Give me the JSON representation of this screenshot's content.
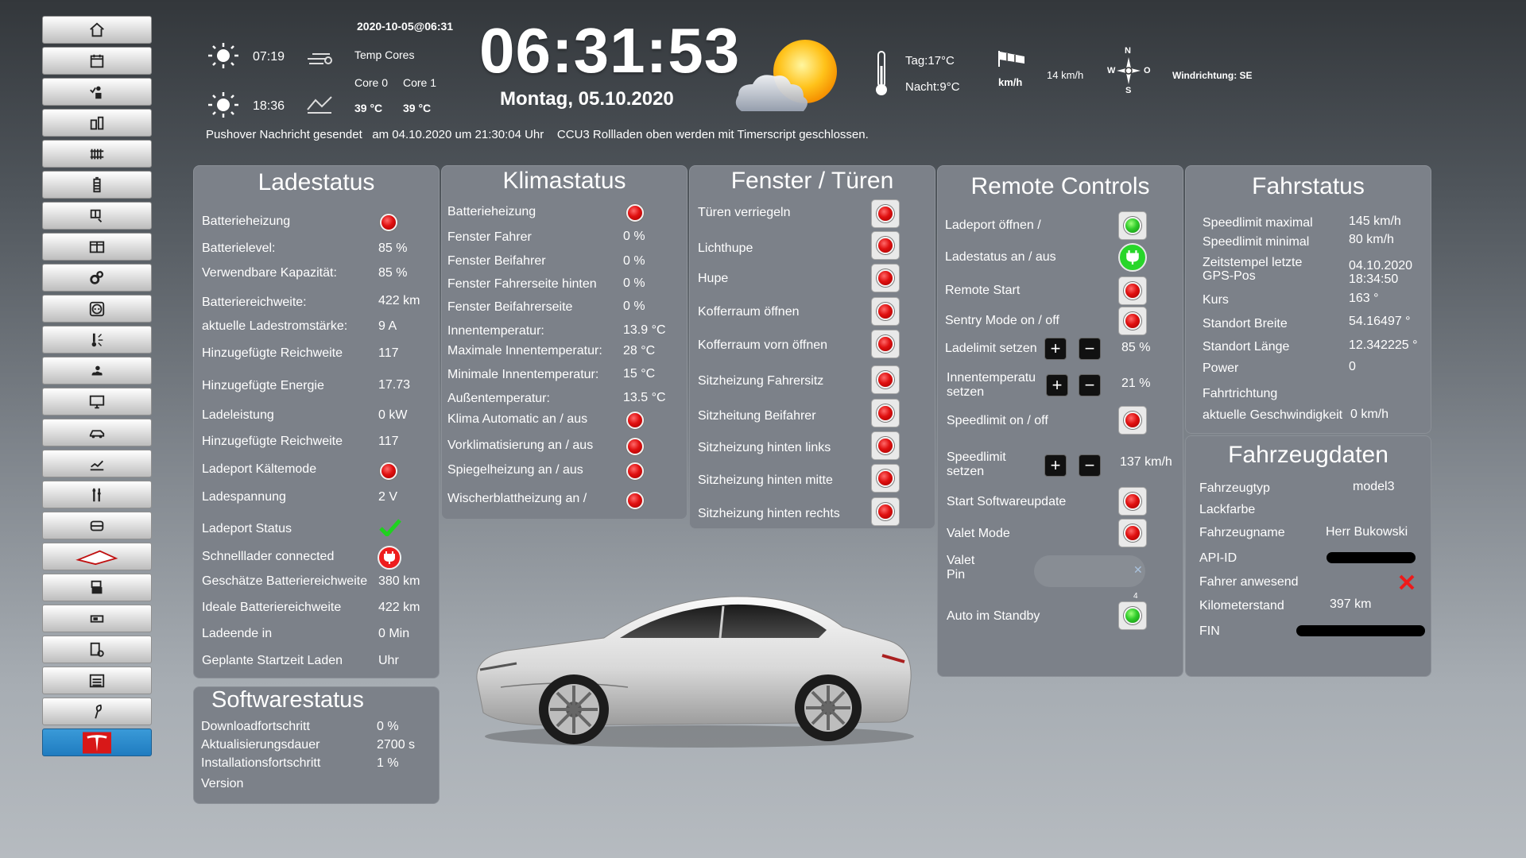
{
  "colors": {
    "panel": "#7c8189",
    "accent_blue": "#1f7cc0",
    "status_red": "#e01010",
    "status_green": "#2fcc2a"
  },
  "sidebar": {
    "items": [
      {
        "icon": "home-icon"
      },
      {
        "icon": "calendar-icon"
      },
      {
        "icon": "person-check-icon"
      },
      {
        "icon": "meter-icon"
      },
      {
        "icon": "radiator-icon"
      },
      {
        "icon": "battery-icon"
      },
      {
        "icon": "window-icon"
      },
      {
        "icon": "split-window-icon"
      },
      {
        "icon": "gears-icon"
      },
      {
        "icon": "socket-icon"
      },
      {
        "icon": "thermometer-icon"
      },
      {
        "icon": "weather-icon"
      },
      {
        "icon": "monitor-icon"
      },
      {
        "icon": "car-icon"
      },
      {
        "icon": "chart-icon"
      },
      {
        "icon": "tools-icon"
      },
      {
        "icon": "vehicle-front-icon"
      },
      {
        "icon": "roof-icon"
      },
      {
        "icon": "printer-icon"
      },
      {
        "icon": "device-icon"
      },
      {
        "icon": "document-gear-icon"
      },
      {
        "icon": "garage-icon"
      },
      {
        "icon": "plant-icon"
      },
      {
        "icon": "tesla-logo-icon",
        "active": true
      }
    ]
  },
  "header": {
    "timestamp": "2020-10-05@06:31",
    "sunrise": "07:19",
    "sunset": "18:36",
    "temp_cores_label": "Temp Cores",
    "core0_label": "Core 0",
    "core1_label": "Core 1",
    "core0_value": "39 °C",
    "core1_value": "39 °C",
    "clock": "06:31:53",
    "date": "Montag, 05.10.2020",
    "day_temp": "Tag:17°C",
    "night_temp": "Nacht:9°C",
    "wind_unit": "km/h",
    "wind_speed": "14 km/h",
    "compass": {
      "n": "N",
      "w": "W",
      "o": "O",
      "s": "S"
    },
    "wind_direction": "Windrichtung: SE",
    "ticker": "Pushover Nachricht gesendet   am 04.10.2020 um 21:30:04 Uhr    CCU3 Rollladen oben werden mit Timerscript geschlossen."
  },
  "ladestatus": {
    "title": "Ladestatus",
    "rows": [
      {
        "label": "Batterieheizung",
        "value": "",
        "indicator": "red"
      },
      {
        "label": "Batterielevel:",
        "value": "85 %"
      },
      {
        "label": "Verwendbare Kapazität:",
        "value": "85 %"
      },
      {
        "label": "Batteriereichweite:",
        "value": "422 km"
      },
      {
        "label": "aktuelle Ladestromstärke:",
        "value": "9 A"
      },
      {
        "label": "Hinzugefügte Reichweite",
        "value": "117"
      },
      {
        "label": "Hinzugefügte Energie",
        "value": "17.73"
      },
      {
        "label": "Ladeleistung",
        "value": "0 kW"
      },
      {
        "label": "Hinzugefügte Reichweite",
        "value": "117"
      },
      {
        "label": "Ladeport Kältemode",
        "value": "",
        "indicator": "red"
      },
      {
        "label": "Ladespannung",
        "value": "2 V"
      },
      {
        "label": "Ladeport Status",
        "value": "",
        "indicator": "check"
      },
      {
        "label": "Schnelllader connected",
        "value": "",
        "indicator": "plug-red"
      },
      {
        "label": "Geschätze Batteriereichweite",
        "value": "380 km"
      },
      {
        "label": "Ideale Batteriereichweite",
        "value": "422 km"
      },
      {
        "label": "Ladeende in",
        "value": "0 Min"
      },
      {
        "label": "Geplante Startzeit Laden",
        "value": "Uhr"
      }
    ]
  },
  "softwarestatus": {
    "title": "Softwarestatus",
    "rows": [
      {
        "label": "Downloadfortschritt",
        "value": "0 %"
      },
      {
        "label": "Aktualisierungsdauer",
        "value": "2700 s"
      },
      {
        "label": "Installationsfortschritt",
        "value": "1 %"
      },
      {
        "label": "Version",
        "value": ""
      }
    ]
  },
  "klimastatus": {
    "title": "Klimastatus",
    "rows": [
      {
        "label": "Batterieheizung",
        "value": "",
        "indicator": "red"
      },
      {
        "label": "Fenster Fahrer",
        "value": "0 %"
      },
      {
        "label": "Fenster Beifahrer",
        "value": "0 %"
      },
      {
        "label": "Fenster Fahrerseite hinten",
        "value": "0 %"
      },
      {
        "label": "Fenster Beifahrerseite",
        "value": "0 %"
      },
      {
        "label": "Innentemperatur:",
        "value": "13.9 °C"
      },
      {
        "label": "Maximale Innentemperatur:",
        "value": "28 °C"
      },
      {
        "label": "Minimale Innentemperatur:",
        "value": "15 °C"
      },
      {
        "label": "Außentemperatur:",
        "value": "13.5 °C"
      },
      {
        "label": "Klima Automatic an / aus",
        "value": "",
        "indicator": "red"
      },
      {
        "label": "Vorklimatisierung an / aus",
        "value": "",
        "indicator": "red"
      },
      {
        "label": "Spiegelheizung an / aus",
        "value": "",
        "indicator": "red"
      },
      {
        "label": "Wischerblattheizung an /",
        "value": "",
        "indicator": "red"
      }
    ]
  },
  "fenster": {
    "title": "Fenster / Türen",
    "rows": [
      {
        "label": "Türen verriegeln"
      },
      {
        "label": "Lichthupe"
      },
      {
        "label": "Hupe"
      },
      {
        "label": "Kofferraum öffnen"
      },
      {
        "label": "Kofferraum vorn öffnen"
      },
      {
        "label": "Sitzheizung Fahrersitz"
      },
      {
        "label": "Sitzheitung Beifahrer"
      },
      {
        "label": "Sitzheizung hinten links"
      },
      {
        "label": "Sitzheizung hinten mitte"
      },
      {
        "label": "Sitzheizung hinten rechts"
      }
    ]
  },
  "remote": {
    "title": "Remote Controls",
    "ladeport": "Ladeport öffnen /",
    "ladestatus": "Ladestatus an / aus",
    "remote_start": "Remote Start",
    "sentry": "Sentry Mode on / off",
    "ladelimit_label": "Ladelimit setzen",
    "ladelimit_value": "85 %",
    "innentemp_label1": "Innentemperatu",
    "innentemp_label2": "setzen",
    "innentemp_value": "21 %",
    "speedlimit_onoff": "Speedlimit on / off",
    "speedlimit_label1": "Speedlimit",
    "speedlimit_label2": "setzen",
    "speedlimit_value": "137 km/h",
    "softwareupdate": "Start Softwareupdate",
    "valet_mode": "Valet Mode",
    "valet_pin1": "Valet",
    "valet_pin2": "Pin",
    "pin_placeholder": "",
    "standby_badge": "4",
    "standby": "Auto im Standby",
    "plus": "+",
    "minus": "−"
  },
  "fahrstatus": {
    "title": "Fahrstatus",
    "rows": [
      {
        "label": "Speedlimit maximal",
        "value": "145 km/h"
      },
      {
        "label": "Speedlimit minimal",
        "value": "80 km/h"
      },
      {
        "label": "Zeitstempel letzte GPS-Pos",
        "value": "04.10.2020 18:34:50"
      },
      {
        "label": "Kurs",
        "value": "163 °"
      },
      {
        "label": "Standort Breite",
        "value": "54.16497 °"
      },
      {
        "label": "Standort Länge",
        "value": "12.342225 °"
      },
      {
        "label": "Power",
        "value": "0"
      },
      {
        "label": "Fahrtrichtung",
        "value": ""
      },
      {
        "label": "aktuelle Geschwindigkeit",
        "value": "0 km/h"
      }
    ]
  },
  "fahrzeugdaten": {
    "title": "Fahrzeugdaten",
    "rows": [
      {
        "label": "Fahrzeugtyp",
        "value": "model3"
      },
      {
        "label": "Lackfarbe",
        "value": ""
      },
      {
        "label": "Fahrzeugname",
        "value": "Herr Bukowski"
      },
      {
        "label": "API-ID",
        "value": "",
        "redacted": true
      },
      {
        "label": "Fahrer anwesend",
        "value": "",
        "indicator": "cross"
      },
      {
        "label": "Kilometerstand",
        "value": "397 km"
      },
      {
        "label": "FIN",
        "value": "",
        "redacted": true
      }
    ]
  }
}
